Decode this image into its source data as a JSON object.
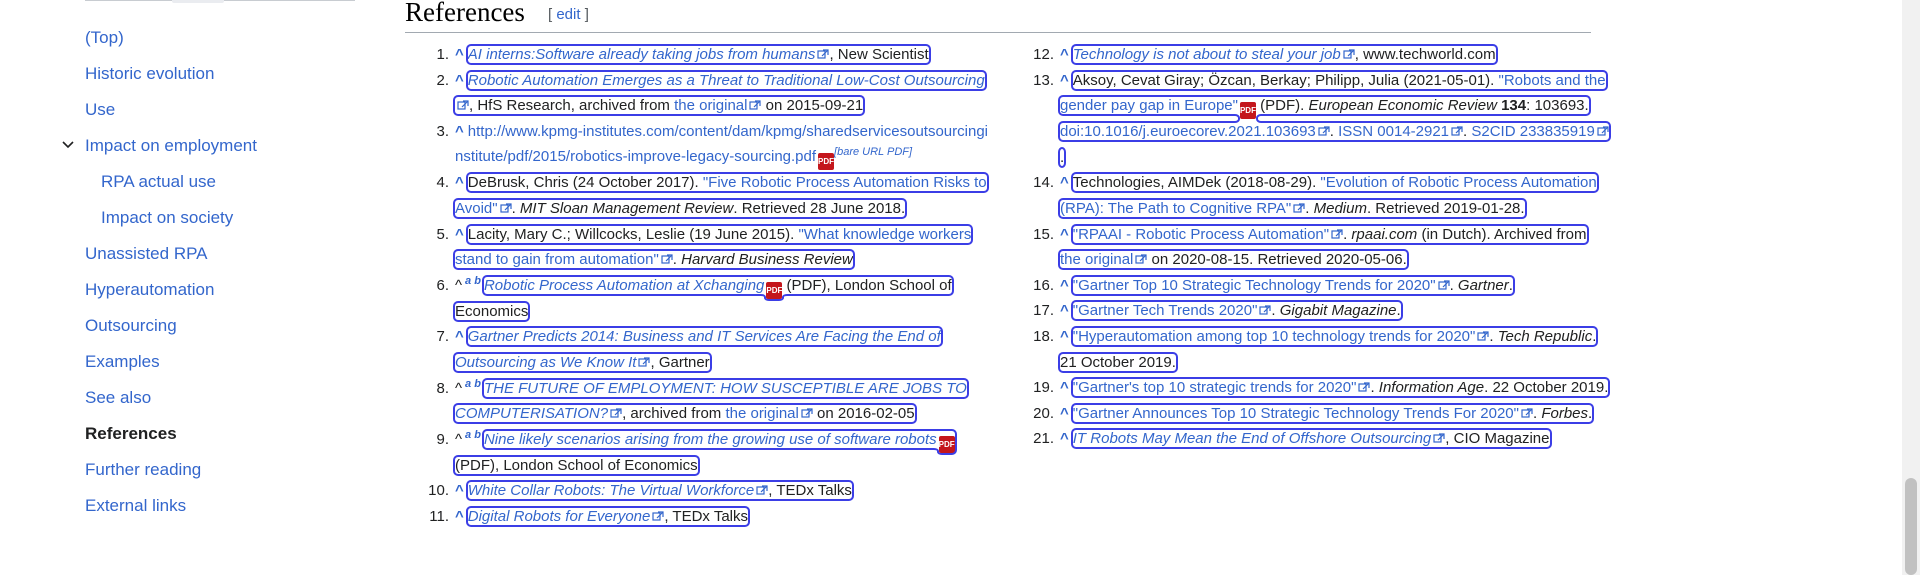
{
  "toc": {
    "items": [
      {
        "label": "(Top)"
      },
      {
        "label": "Historic evolution"
      },
      {
        "label": "Use"
      },
      {
        "label": "Impact on employment"
      },
      {
        "label": "RPA actual use"
      },
      {
        "label": "Impact on society"
      },
      {
        "label": "Unassisted RPA"
      },
      {
        "label": "Hyperautomation"
      },
      {
        "label": "Outsourcing"
      },
      {
        "label": "Examples"
      },
      {
        "label": "See also"
      },
      {
        "label": "References"
      },
      {
        "label": "Further reading"
      },
      {
        "label": "External links"
      }
    ],
    "active_item": "References"
  },
  "section": {
    "title": "References",
    "edit_open": "[",
    "edit_label": "edit",
    "edit_close": "]"
  },
  "refs": [
    {
      "n": "1.",
      "caret": "^",
      "title": "AI interns:Software already taking jobs from humans",
      "rest": ", New Scientist"
    },
    {
      "n": "2.",
      "caret": "^",
      "title": "Robotic Automation Emerges as a Threat to Traditional Low-Cost Outsourcing",
      "mid": ", HfS Research, archived from ",
      "link2": "the original",
      "rest": " on 2015-09-21"
    },
    {
      "n": "3.",
      "caret": "^",
      "url": "http://www.kpmg-institutes.com/content/dam/kpmg/sharedservicesoutsourcinginstitute/pdf/2015/robotics-improve-legacy-sourcing.pdf",
      "pdf": "PDF",
      "bare": "[bare URL PDF]"
    },
    {
      "n": "4.",
      "caret": "^",
      "pre": "DeBrusk, Chris (24 October 2017). ",
      "title": "\"Five Robotic Process Automation Risks to Avoid\"",
      "src": "MIT Sloan Management Review",
      "rest": ". Retrieved 28 June 2018."
    },
    {
      "n": "5.",
      "caret": "^",
      "pre": "Lacity, Mary C.; Willcocks, Leslie (19 June 2015). ",
      "title": "\"What knowledge workers stand to gain from automation\"",
      "src": "Harvard Business Review"
    },
    {
      "n": "6.",
      "caret": "^",
      "sup": "a b",
      "title": "Robotic Process Automation at Xchanging",
      "pdf": "PDF",
      "rest": " (PDF), London School of Economics"
    },
    {
      "n": "7.",
      "caret": "^",
      "title": "Gartner Predicts 2014: Business and IT Services Are Facing the End of Outsourcing as We Know It",
      "rest": ", Gartner"
    },
    {
      "n": "8.",
      "caret": "^",
      "sup": "a b",
      "title": "THE FUTURE OF EMPLOYMENT: HOW SUSCEPTIBLE ARE JOBS TO COMPUTERISATION?",
      "mid": ", archived from ",
      "link2": "the original",
      "rest": " on 2016-02-05"
    },
    {
      "n": "9.",
      "caret": "^",
      "sup": "a b",
      "title": "Nine likely scenarios arising from the growing use of software robots",
      "pdf": "PDF",
      "rest": " (PDF), London School of Economics"
    },
    {
      "n": "10.",
      "caret": "^",
      "title": "White Collar Robots: The Virtual Workforce",
      "rest": ", TEDx Talks"
    },
    {
      "n": "11.",
      "caret": "^",
      "title": "Digital Robots for Everyone",
      "rest": ", TEDx Talks"
    },
    {
      "n": "12.",
      "caret": "^",
      "title": "Technology is not about to steal your job",
      "rest": ", www.techworld.com"
    },
    {
      "n": "13.",
      "caret": "^",
      "pre": "Aksoy, Cevat Giray; Özcan, Berkay; Philipp, Julia (2021-05-01). ",
      "title": "\"Robots and the gender pay gap in Europe\"",
      "pdf": "PDF",
      "mid": " (PDF). ",
      "src": "European Economic Review",
      "vol": "134",
      "pages": ": 103693. ",
      "doi": "doi:10.1016/j.euroecorev.2021.103693",
      "issn": "ISSN 0014-2921",
      "s2cid": "S2CID 233835919",
      "end": "."
    },
    {
      "n": "14.",
      "caret": "^",
      "pre": "Technologies, AIMDek (2018-08-29). ",
      "title": "\"Evolution of Robotic Process Automation (RPA): The Path to Cognitive RPA\"",
      "src": "Medium",
      "rest": ". Retrieved 2019-01-28."
    },
    {
      "n": "15.",
      "caret": "^",
      "title": "\"RPAAI - Robotic Process Automation\"",
      "src": "rpaai.com",
      "mid": " (in Dutch). Archived from ",
      "link2": "the original",
      "rest": " on 2020-08-15. Retrieved 2020-05-06."
    },
    {
      "n": "16.",
      "caret": "^",
      "title": "\"Gartner Top 10 Strategic Technology Trends for 2020\"",
      "src": "Gartner",
      "end": "."
    },
    {
      "n": "17.",
      "caret": "^",
      "title": "\"Gartner Tech Trends 2020\"",
      "src": "Gigabit Magazine",
      "end": "."
    },
    {
      "n": "18.",
      "caret": "^",
      "title": "\"Hyperautomation among top 10 technology trends for 2020\"",
      "src": "Tech Republic",
      "rest": ". 21 October 2019."
    },
    {
      "n": "19.",
      "caret": "^",
      "title": "\"Gartner's top 10 strategic trends for 2020\"",
      "src": "Information Age",
      "rest": ". 22 October 2019."
    },
    {
      "n": "20.",
      "caret": "^",
      "title": "\"Gartner Announces Top 10 Strategic Technology Trends For 2020\"",
      "src": "Forbes",
      "end": "."
    },
    {
      "n": "21.",
      "caret": "^",
      "title": "IT Robots May Mean the End of Offshore Outsourcing",
      "rest": ", CIO Magazine"
    }
  ]
}
